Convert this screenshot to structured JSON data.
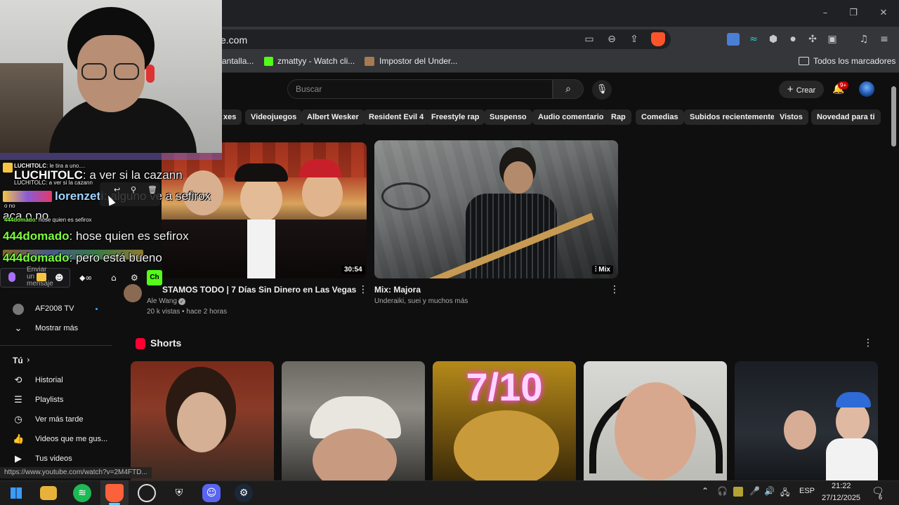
{
  "browser": {
    "url": "e.com",
    "bookmarks": [
      "antalla...",
      "zmattyy - Watch cli...",
      "Impostor del Under..."
    ],
    "all_bookmarks": "Todos los marcadores",
    "status_url": "https://www.youtube.com/watch?v=2M4FTD..."
  },
  "youtube": {
    "search_placeholder": "Buscar",
    "create_label": "Crear",
    "notifications_badge": "9+",
    "chips": [
      "xes",
      "Videojuegos",
      "Albert Wesker",
      "Resident Evil 4",
      "Freestyle rap",
      "Suspenso",
      "Audio comentario",
      "Rap",
      "Comedias",
      "Subidos recientemente",
      "Vistos",
      "Novedad para ti"
    ],
    "videos": [
      {
        "title": "STAMOS TODO | 7 Días Sin Dinero en Las Vegas",
        "channel": "Ale Wang",
        "meta": "20 k vistas • hace 2 horas",
        "duration": "30:54"
      },
      {
        "title": "Mix: Majora",
        "channel": "Underaiki, suei y muchos más",
        "badge": "Mix"
      }
    ],
    "shorts_title": "Shorts",
    "shorts_overlay_text": "7/10"
  },
  "sidebar": {
    "subscription": "AF2008 TV",
    "show_more": "Mostrar más",
    "you_section": "Tú",
    "items": [
      "Historial",
      "Playlists",
      "Ver más tarde",
      "Videos que me gus...",
      "Tus videos"
    ]
  },
  "chat": {
    "lines": [
      {
        "user": "LUCHITOLC",
        "text": "a ver si la cazann",
        "big": true
      },
      {
        "user": "lorenzeti",
        "text": "alguno ve a sefirox",
        "big": true
      },
      {
        "user": "",
        "text": "aca o no",
        "big": true
      },
      {
        "user": "444domado",
        "text": "hose quien es sefirox",
        "big": true
      },
      {
        "user": "444domado",
        "text": "pero está bueno",
        "big": true
      }
    ],
    "small_lines": [
      {
        "user": "LUCHITOLC",
        "text": "le tira a uno...."
      },
      {
        "user": "LUCHITOLC",
        "text": "a ver si la cazann"
      },
      {
        "user": "",
        "text": "o no"
      },
      {
        "user": "444domado",
        "text": "hose quien es sefirox"
      }
    ],
    "input_placeholder": "Enviar un mensaje",
    "chat_button": "Ch"
  },
  "taskbar": {
    "language": "ESP",
    "time": "21:22",
    "date": "27/12/2025",
    "notif_count": "6"
  }
}
